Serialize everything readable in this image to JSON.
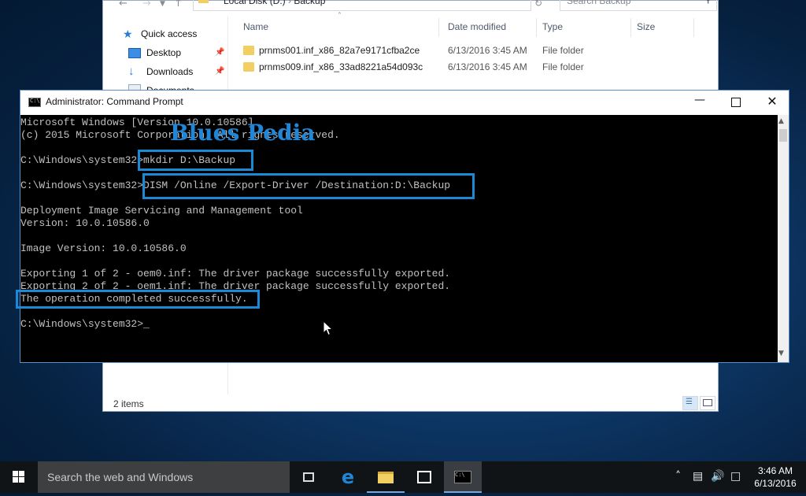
{
  "explorer": {
    "path_root": "Local Disk (D:)",
    "path_leaf": "Backup",
    "search_placeholder": "Search Backup",
    "sidebar": [
      {
        "label": "Quick access",
        "icon": "star-icon"
      },
      {
        "label": "Desktop",
        "icon": "desktop-icon"
      },
      {
        "label": "Downloads",
        "icon": "download-icon"
      },
      {
        "label": "Documents",
        "icon": "documents-icon"
      }
    ],
    "columns": [
      "Name",
      "Date modified",
      "Type",
      "Size"
    ],
    "rows": [
      {
        "name": "prnms001.inf_x86_82a7e9171cfba2ce",
        "date": "6/13/2016 3:45 AM",
        "type": "File folder"
      },
      {
        "name": "prnms009.inf_x86_33ad8221a54d093c",
        "date": "6/13/2016 3:45 AM",
        "type": "File folder"
      }
    ],
    "status": "2 items"
  },
  "cmd": {
    "title": "Administrator: Command Prompt",
    "watermark": "Blues Pedia",
    "lines": [
      "Microsoft Windows [Version 10.0.10586]",
      "(c) 2015 Microsoft Corporation. All rights reserved.",
      "",
      "C:\\Windows\\system32>mkdir D:\\Backup",
      "",
      "C:\\Windows\\system32>DISM /Online /Export-Driver /Destination:D:\\Backup",
      "",
      "Deployment Image Servicing and Management tool",
      "Version: 10.0.10586.0",
      "",
      "Image Version: 10.0.10586.0",
      "",
      "Exporting 1 of 2 - oem0.inf: The driver package successfully exported.",
      "Exporting 2 of 2 - oem1.inf: The driver package successfully exported.",
      "The operation completed successfully.",
      "",
      "C:\\Windows\\system32>_"
    ],
    "highlight_color": "#1a8ad6"
  },
  "taskbar": {
    "search_placeholder": "Search the web and Windows",
    "time": "3:46 AM",
    "date": "6/13/2016"
  }
}
